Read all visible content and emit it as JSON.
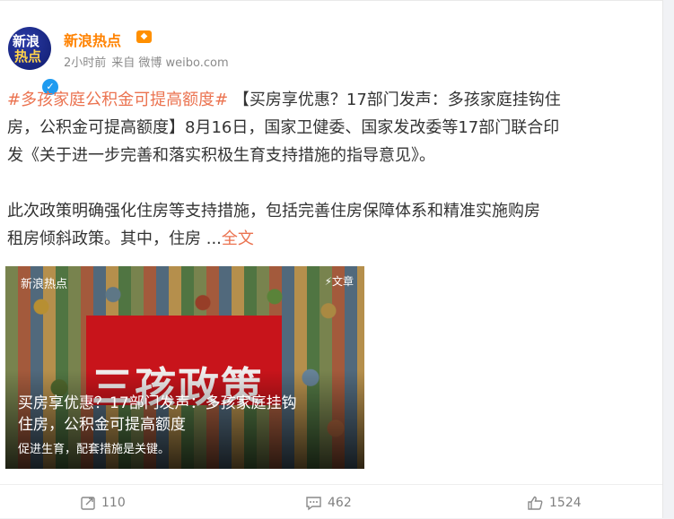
{
  "post": {
    "author": "新浪热点",
    "avatar_text_line1": "新浪",
    "avatar_text_line2": "热点",
    "meta_time": "2小时前",
    "meta_source": "来自 微博 weibo.com",
    "content_lines": [
      {
        "link": "#多孩家庭公积金可提高额度#",
        "text": " 【买房享优惠？17部门发声：多孩家庭挂钩住"
      },
      {
        "text": "房，公积金可提高额度】8月16日，国家卫健委、国家发改委等17部门联合印"
      },
      {
        "text": "发《关于进一步完善和落实积极生育支持措施的指导意见》。"
      },
      {
        "text": "此次政策明确强化住房等支持措施，包括完善住房保障体系和精准实施购房"
      },
      {
        "text": "租房倾斜政策。其中，住房 ...",
        "link": "全文"
      }
    ]
  },
  "card": {
    "source_label": "新浪热点",
    "type_label": "⚡文章",
    "board_text": "三孩政策",
    "title_line1": "买房享优惠？17部门发声：多孩家庭挂钩",
    "title_line2": "住房，公积金可提高额度",
    "subtitle": "促进生育，配套措施是关键。"
  },
  "actions": {
    "repost_count": "110",
    "comment_count": "462",
    "like_count": "1524"
  },
  "colors": {
    "author": "#ff8200",
    "link": "#eb7350",
    "board": "#c8141b"
  },
  "icons": [
    "verified-badge-icon",
    "vip-icon",
    "repost-icon",
    "comment-icon",
    "like-icon"
  ]
}
